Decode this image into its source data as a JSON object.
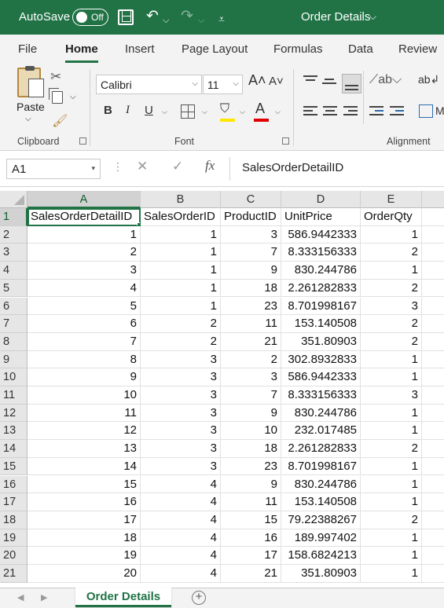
{
  "titlebar": {
    "autosave_label": "AutoSave",
    "autosave_state": "Off",
    "doc_title": "Order Details",
    "chevron": "⌵",
    "icons": [
      "save-icon",
      "undo-icon",
      "redo-icon",
      "customize-qat-icon"
    ]
  },
  "ribbon": {
    "tabs": [
      "File",
      "Home",
      "Insert",
      "Page Layout",
      "Formulas",
      "Data",
      "Review"
    ],
    "active_tab": "Home",
    "groups": {
      "clipboard": "Clipboard",
      "font": "Font",
      "alignment": "Alignment"
    },
    "paste_label": "Paste",
    "font_name": "Calibri",
    "font_size": "11",
    "bold": "B",
    "italic": "I",
    "underline": "U",
    "grow_font": "A˄",
    "shrink_font": "A˅",
    "font_color_glyph": "A",
    "merge_m": "M",
    "colors": {
      "accent": "#217346",
      "fill": "#ffe600",
      "font_color": "#e00000"
    }
  },
  "formula_bar": {
    "name_box": "A1",
    "fx": "fx",
    "content": "SalesOrderDetailID"
  },
  "sheet": {
    "columns": [
      "A",
      "B",
      "C",
      "D",
      "E"
    ],
    "selected_column": "A",
    "active_cell": "A1",
    "rows": [
      {
        "n": "1",
        "cells": [
          "SalesOrderDetailID",
          "SalesOrderID",
          "ProductID",
          "UnitPrice",
          "OrderQty"
        ]
      },
      {
        "n": "2",
        "cells": [
          "1",
          "1",
          "3",
          "586.9442333",
          "1"
        ]
      },
      {
        "n": "3",
        "cells": [
          "2",
          "1",
          "7",
          "8.333156333",
          "2"
        ]
      },
      {
        "n": "4",
        "cells": [
          "3",
          "1",
          "9",
          "830.244786",
          "1"
        ]
      },
      {
        "n": "5",
        "cells": [
          "4",
          "1",
          "18",
          "2.261282833",
          "2"
        ]
      },
      {
        "n": "6",
        "cells": [
          "5",
          "1",
          "23",
          "8.701998167",
          "3"
        ]
      },
      {
        "n": "7",
        "cells": [
          "6",
          "2",
          "11",
          "153.140508",
          "2"
        ]
      },
      {
        "n": "8",
        "cells": [
          "7",
          "2",
          "21",
          "351.80903",
          "2"
        ]
      },
      {
        "n": "9",
        "cells": [
          "8",
          "3",
          "2",
          "302.8932833",
          "1"
        ]
      },
      {
        "n": "10",
        "cells": [
          "9",
          "3",
          "3",
          "586.9442333",
          "1"
        ]
      },
      {
        "n": "11",
        "cells": [
          "10",
          "3",
          "7",
          "8.333156333",
          "3"
        ]
      },
      {
        "n": "12",
        "cells": [
          "11",
          "3",
          "9",
          "830.244786",
          "1"
        ]
      },
      {
        "n": "13",
        "cells": [
          "12",
          "3",
          "10",
          "232.017485",
          "1"
        ]
      },
      {
        "n": "14",
        "cells": [
          "13",
          "3",
          "18",
          "2.261282833",
          "2"
        ]
      },
      {
        "n": "15",
        "cells": [
          "14",
          "3",
          "23",
          "8.701998167",
          "1"
        ]
      },
      {
        "n": "16",
        "cells": [
          "15",
          "4",
          "9",
          "830.244786",
          "1"
        ]
      },
      {
        "n": "17",
        "cells": [
          "16",
          "4",
          "11",
          "153.140508",
          "1"
        ]
      },
      {
        "n": "18",
        "cells": [
          "17",
          "4",
          "15",
          "79.22388267",
          "2"
        ]
      },
      {
        "n": "19",
        "cells": [
          "18",
          "4",
          "16",
          "189.997402",
          "1"
        ]
      },
      {
        "n": "20",
        "cells": [
          "19",
          "4",
          "17",
          "158.6824213",
          "1"
        ]
      },
      {
        "n": "21",
        "cells": [
          "20",
          "4",
          "21",
          "351.80903",
          "1"
        ]
      }
    ],
    "sheet_tab": "Order Details",
    "add_sheet": "+"
  }
}
